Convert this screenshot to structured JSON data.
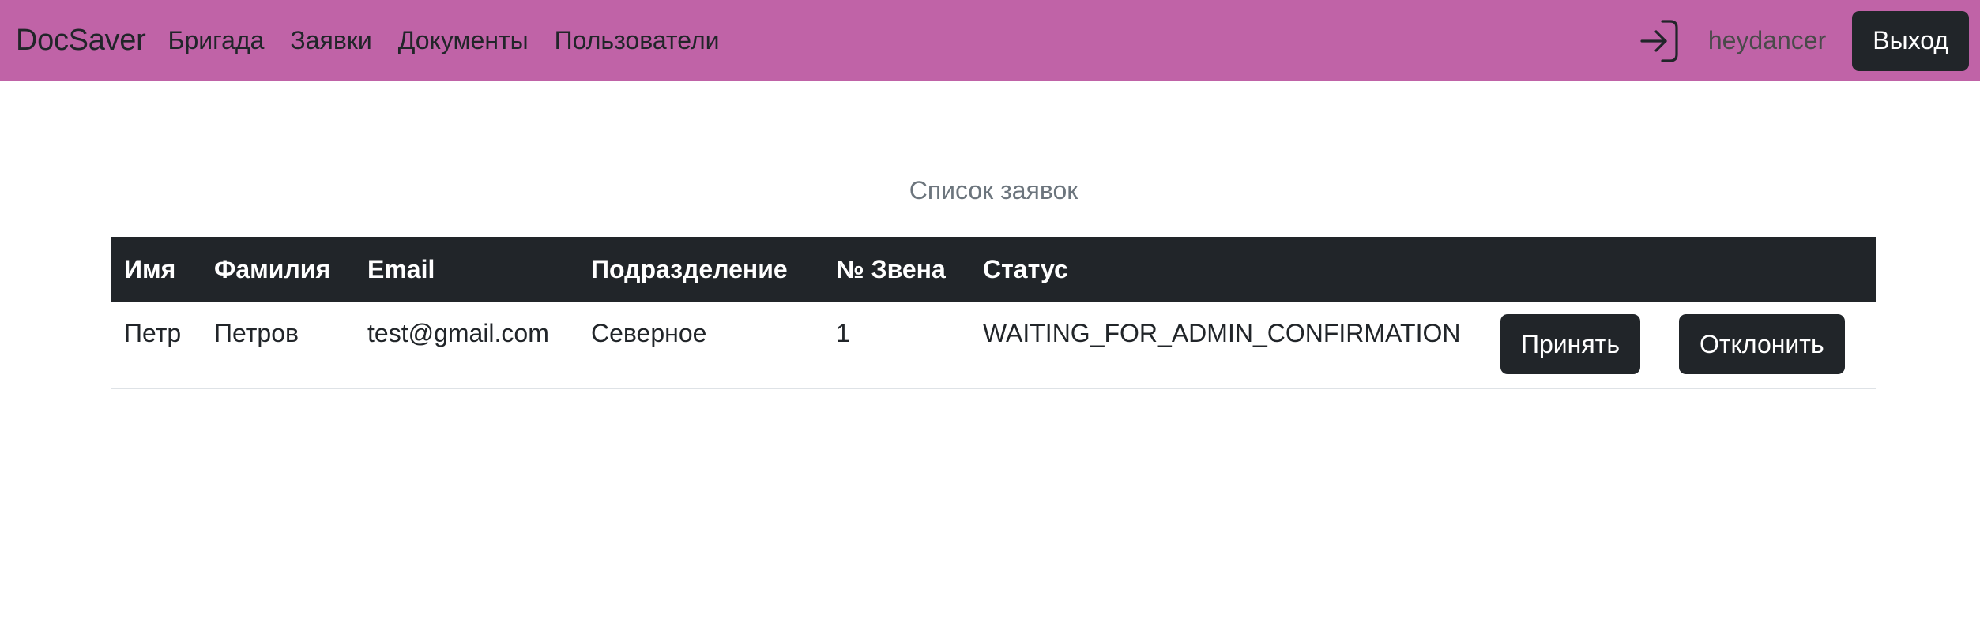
{
  "navbar": {
    "brand": "DocSaver",
    "links": [
      "Бригада",
      "Заявки",
      "Документы",
      "Пользователи"
    ],
    "username": "heydancer",
    "logout_label": "Выход",
    "login_icon": "login-arrow-icon",
    "background": "#c063a7"
  },
  "main": {
    "caption": "Список заявок",
    "table": {
      "headers": [
        "Имя",
        "Фамилия",
        "Email",
        "Подразделение",
        "№ Звена",
        "Статус"
      ],
      "rows": [
        {
          "first_name": "Петр",
          "last_name": "Петров",
          "email": "test@gmail.com",
          "division": "Северное",
          "unit_number": "1",
          "status": "WAITING_FOR_ADMIN_CONFIRMATION",
          "accept_label": "Принять",
          "reject_label": "Отклонить"
        }
      ]
    }
  }
}
